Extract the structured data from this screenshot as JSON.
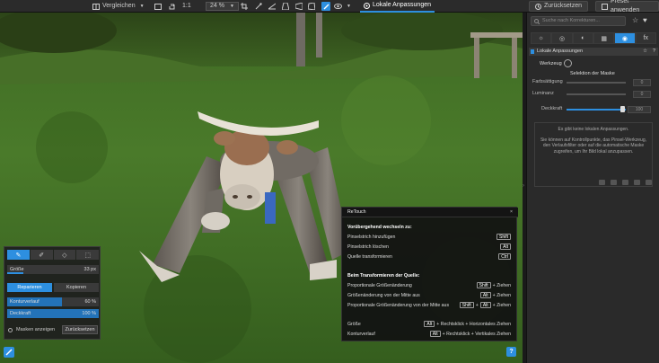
{
  "toolbar": {
    "compare_label": "Vergleichen",
    "zoom_ratio": "1:1",
    "zoom_value": "24 %",
    "local_adjust_label": "Lokale Anpassungen",
    "reset_label": "Zurücksetzen",
    "apply_preset_label": "Preset anwenden"
  },
  "right_panel": {
    "search_placeholder": "Suche nach Korrekturen...",
    "section_title": "Lokale Anpassungen",
    "tool_label": "Werkzeug",
    "mask_selection_label": "Selektion der Maske",
    "saturation_label": "Farbsättigung",
    "luminance_label": "Luminanz",
    "opacity_label": "Deckkraft",
    "saturation_value": "0",
    "luminance_value": "0",
    "opacity_value": "100",
    "empty_title": "Es gibt keine lokalen Anpassungen.",
    "empty_body": "Sie können auf Kontrollpunkte, das Pinsel-Werkzeug, den Verlaufsfilter oder auf die automatische Maske zugreifen, um Ihr Bild lokal anzupassen."
  },
  "brush_panel": {
    "size_label": "Größe",
    "size_value": "33 px",
    "repair_label": "Reparieren",
    "copy_label": "Kopieren",
    "feather_label": "Konturverlauf",
    "feather_value": "60 %",
    "opacity_label": "Deckkraft",
    "opacity_value": "100 %",
    "show_masks_label": "Masken anzeigen",
    "reset_label": "Zurücksetzen",
    "feather_fraction": 0.6,
    "opacity_fraction": 1.0
  },
  "retouch_popup": {
    "title": "ReTouch",
    "close": "×",
    "section1": "Vorübergehend wechseln zu:",
    "add_stroke": "Pinselstrich hinzufügen",
    "add_stroke_key": "Shift",
    "delete_stroke": "Pinselstrich löschen",
    "delete_stroke_key": "Alt",
    "transform_source": "Quelle transformieren",
    "transform_source_key": "Ctrl",
    "section2": "Beim Transformieren der Quelle:",
    "prop_resize": "Proportionale Größenänderung",
    "prop_resize_key1": "Shift",
    "prop_resize_suffix": "+ Ziehen",
    "center_resize": "Größenänderung von der Mitte aus",
    "center_resize_key1": "Alt",
    "center_resize_suffix": "+ Ziehen",
    "prop_center_resize": "Proportionale Größenänderung von der Mitte aus",
    "prop_center_key1": "Shift",
    "prop_center_plus": "+",
    "prop_center_key2": "Alt",
    "prop_center_suffix": "+ Ziehen",
    "size_label": "Größe",
    "size_key": "Alt",
    "size_suffix": "+ Rechtsklick + Horizontales Ziehen",
    "feather_label": "Konturverlauf",
    "feather_key": "Alt",
    "feather_suffix": "+ Rechtsklick + Vertikales Ziehen"
  },
  "help_label": "?",
  "colors": {
    "accent": "#2d8fe0"
  }
}
